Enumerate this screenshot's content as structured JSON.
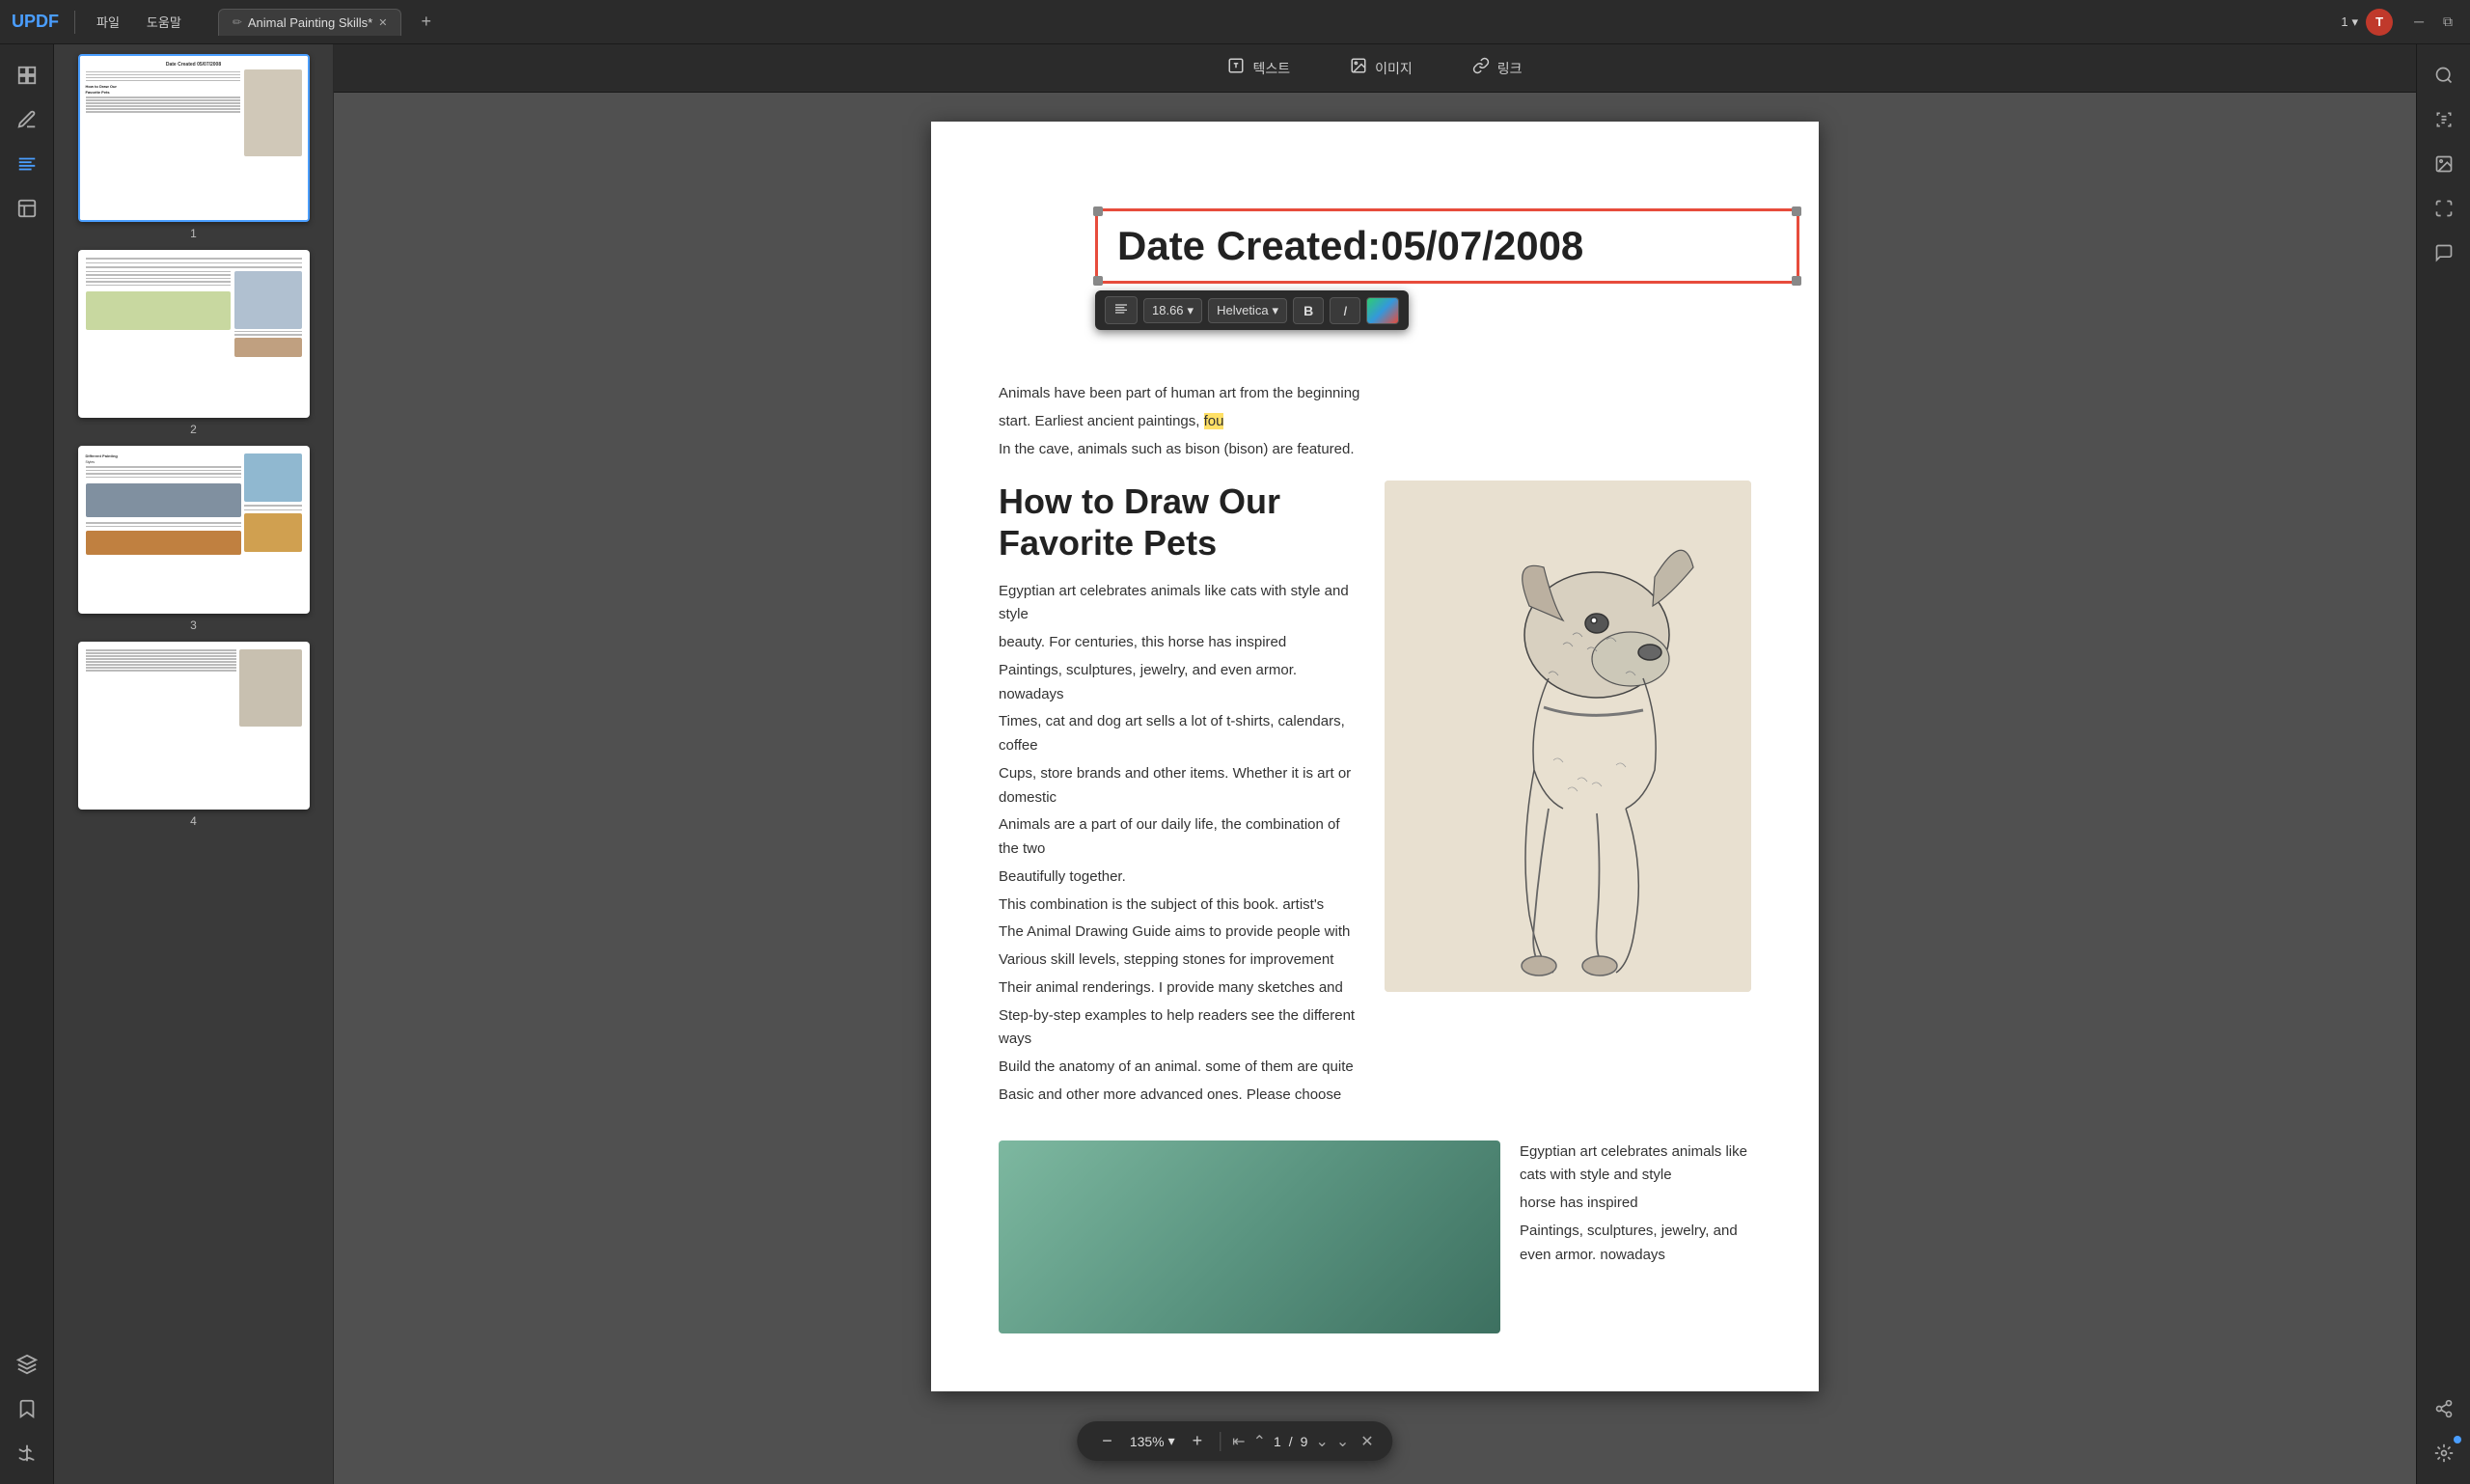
{
  "app": {
    "logo": "UPDF",
    "menus": [
      "파일",
      "도움말"
    ]
  },
  "tab": {
    "title": "Animal Painting Skills*",
    "icon": "✏️"
  },
  "window": {
    "page_counter": "1",
    "page_counter_arrow": "▾"
  },
  "toolbar": {
    "text_tool": "텍스트",
    "image_tool": "이미지",
    "link_tool": "링크"
  },
  "text_selection": {
    "content": "Date Created:05/07/2008"
  },
  "fmt_toolbar": {
    "font_size": "18.66",
    "font_family": "Helvetica",
    "bold": "B",
    "italic": "I"
  },
  "page_content": {
    "intro_line1": "Animals have been part of human art from the beginning",
    "intro_line2": "start. Earliest ancient paintings fou",
    "intro_line3": "In the cave, animals such as bison (bison) are featured.",
    "section_heading_line1": "How to Draw Our",
    "section_heading_line2": "Favorite Pets",
    "body_lines": [
      "Egyptian art celebrates animals like cats with style and style",
      "beauty. For centuries, this horse has inspired",
      "Paintings, sculptures, jewelry, and even armor. nowadays",
      "Times, cat and dog art sells a lot of t-shirts, calendars, coffee",
      "Cups, store brands and other items. Whether it is art or domestic",
      "Animals are a part of our daily life, the combination of the two",
      "Beautifully together.",
      "This combination is the subject of this book. artist's",
      "The Animal Drawing Guide aims to provide people with",
      "Various skill levels, stepping stones for improvement",
      "Their animal renderings. I provide many sketches and",
      "Step-by-step examples to help readers see the different ways",
      "Build the anatomy of an animal. some of them are quite",
      "Basic and other more advanced ones. Please choose"
    ],
    "bottom_text_lines": [
      "Egyptian art celebrates animals like cats with style and style",
      "horse has inspired",
      "Paintings, sculptures, jewelry, and even armor. nowadays"
    ]
  },
  "zoom": {
    "value": "135%",
    "minus": "−",
    "plus": "+"
  },
  "page_nav": {
    "current": "1",
    "total": "9"
  },
  "thumbnails": [
    {
      "page": "1",
      "active": true
    },
    {
      "page": "2",
      "active": false
    },
    {
      "page": "3",
      "active": false
    },
    {
      "page": "4",
      "active": false
    }
  ],
  "sidebar_icons": {
    "home": "⊞",
    "pen": "✏",
    "text": "≡",
    "book": "📋",
    "layers": "◧",
    "bookmark": "🔖",
    "signature": "✒"
  },
  "right_sidebar_icons": {
    "ocr": "OCR",
    "image": "🖼",
    "convert": "⇄",
    "comment": "💬",
    "share": "↑",
    "ai": "AI"
  }
}
